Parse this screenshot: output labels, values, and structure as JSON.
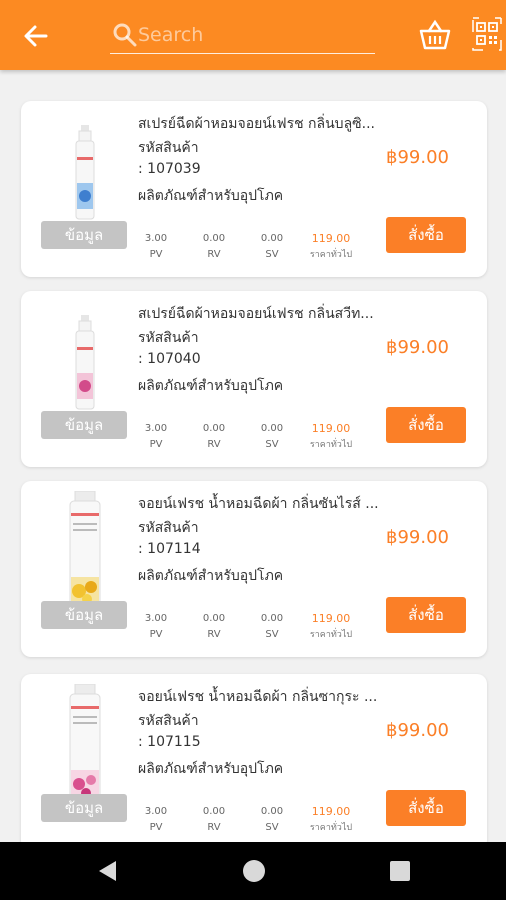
{
  "header": {
    "search_placeholder": "Search",
    "accent_color": "#fc8a22"
  },
  "products": [
    {
      "name": "สเปรย์ฉีดผ้าหอมจอยน์เฟรช กลิ่นบลูซิ...",
      "code_label": "รหัสสินค้า",
      "code": ": 107039",
      "category": "ผลิตภัณฑ์สำหรับอุปโภค",
      "price": "฿99.00",
      "pv_value": "3.00",
      "pv_label": "PV",
      "rv_value": "0.00",
      "rv_label": "RV",
      "sv_value": "0.00",
      "sv_label": "SV",
      "retail_price": "119.00",
      "retail_label": "ราคาทั่วไป",
      "info_label": "ข้อมูล",
      "buy_label": "สั่งซื้อ",
      "image": "spray-bottle-blue-label"
    },
    {
      "name": "สเปรย์ฉีดผ้าหอมจอยน์เฟรช กลิ่นสวีท...",
      "code_label": "รหัสสินค้า",
      "code": ": 107040",
      "category": "ผลิตภัณฑ์สำหรับอุปโภค",
      "price": "฿99.00",
      "pv_value": "3.00",
      "pv_label": "PV",
      "rv_value": "0.00",
      "rv_label": "RV",
      "sv_value": "0.00",
      "sv_label": "SV",
      "retail_price": "119.00",
      "retail_label": "ราคาทั่วไป",
      "info_label": "ข้อมูล",
      "buy_label": "สั่งซื้อ",
      "image": "spray-bottle-pink-label"
    },
    {
      "name": "จอยน์เฟรช น้ำหอมฉีดผ้า กลิ่นซันไรส์ ...",
      "code_label": "รหัสสินค้า",
      "code": ": 107114",
      "category": "ผลิตภัณฑ์สำหรับอุปโภค",
      "price": "฿99.00",
      "pv_value": "3.00",
      "pv_label": "PV",
      "rv_value": "0.00",
      "rv_label": "RV",
      "sv_value": "0.00",
      "sv_label": "SV",
      "retail_price": "119.00",
      "retail_label": "ราคาทั่วไป",
      "info_label": "ข้อมูล",
      "buy_label": "สั่งซื้อ",
      "image": "spray-bottle-yellow-flowers"
    },
    {
      "name": "จอยน์เฟรช น้ำหอมฉีดผ้า กลิ่นซากุระ ...",
      "code_label": "รหัสสินค้า",
      "code": ": 107115",
      "category": "ผลิตภัณฑ์สำหรับอุปโภค",
      "price": "฿99.00",
      "pv_value": "3.00",
      "pv_label": "PV",
      "rv_value": "0.00",
      "rv_label": "RV",
      "sv_value": "0.00",
      "sv_label": "SV",
      "retail_price": "119.00",
      "retail_label": "ราคาทั่วไป",
      "info_label": "ข้อมูล",
      "buy_label": "สั่งซื้อ",
      "image": "spray-bottle-pink-flowers"
    }
  ],
  "icons": {
    "back": "arrow-left-icon",
    "search": "search-icon",
    "basket": "basket-icon",
    "qr": "qr-code-icon"
  }
}
